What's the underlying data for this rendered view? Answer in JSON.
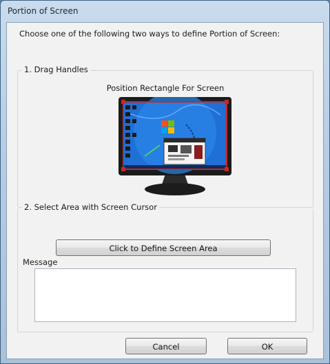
{
  "window": {
    "title": "Portion of Screen"
  },
  "instruction": "Choose one of the following two ways to define Portion of Screen:",
  "drag_group": {
    "label": "1. Drag Handles",
    "caption": "Position Rectangle For Screen"
  },
  "cursor_group": {
    "label": "2. Select Area with Screen Cursor",
    "button_label": "Click to Define Screen Area"
  },
  "message": {
    "label": "Message",
    "value": ""
  },
  "buttons": {
    "cancel": "Cancel",
    "ok": "OK"
  },
  "colors": {
    "title_bar": "#b7cde4",
    "dialog_bg": "#f2f2f2",
    "selection_rect": "#c62828",
    "desktop_blue": "#1f6fd6"
  }
}
